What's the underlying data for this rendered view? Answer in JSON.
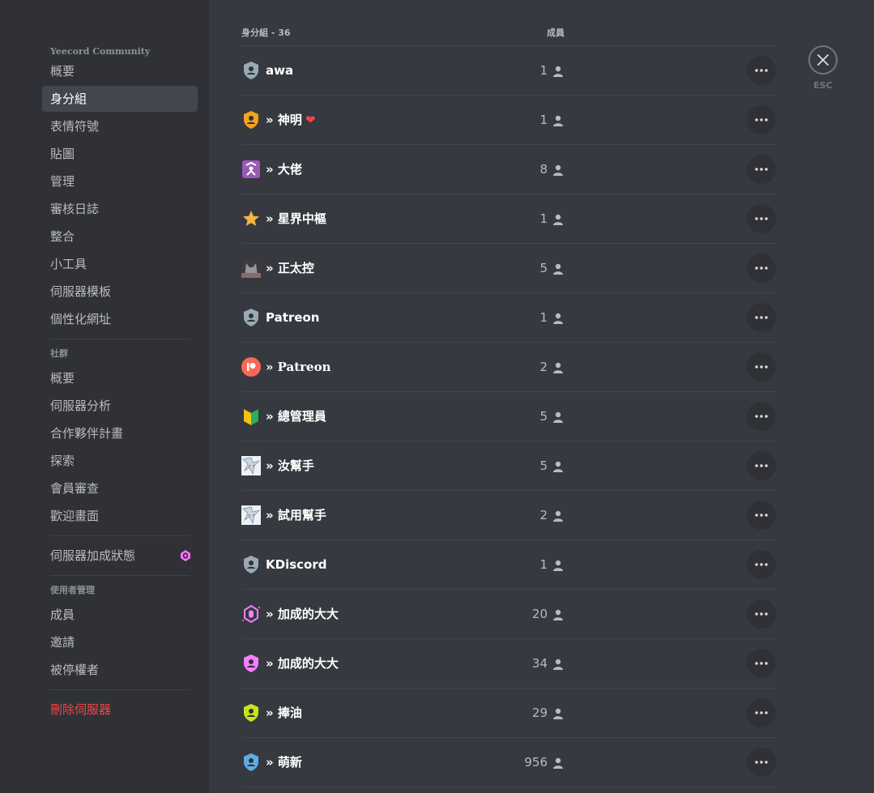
{
  "sidebar": {
    "server_name": "Yeecord Community",
    "server_items": [
      {
        "label": "概要"
      },
      {
        "label": "身分組",
        "active": true
      },
      {
        "label": "表情符號"
      },
      {
        "label": "貼圖"
      },
      {
        "label": "管理"
      },
      {
        "label": "審核日誌"
      },
      {
        "label": "整合"
      },
      {
        "label": "小工具"
      },
      {
        "label": "伺服器模板"
      },
      {
        "label": "個性化網址"
      }
    ],
    "community_header": "社群",
    "community_items": [
      {
        "label": "概要"
      },
      {
        "label": "伺服器分析"
      },
      {
        "label": "合作夥伴計畫"
      },
      {
        "label": "探索"
      },
      {
        "label": "會員審查"
      },
      {
        "label": "歡迎畫面"
      }
    ],
    "boost_label": "伺服器加成狀態",
    "user_mgmt_header": "使用者管理",
    "user_mgmt_items": [
      {
        "label": "成員"
      },
      {
        "label": "邀請"
      },
      {
        "label": "被停權者"
      }
    ],
    "delete_label": "刪除伺服器"
  },
  "roles_header": "身分組 - 36",
  "members_header": "成員",
  "roles": [
    {
      "name": "awa",
      "count": "1",
      "icon": "shield-person-icon",
      "color": "#99aab5"
    },
    {
      "name": "» 神明",
      "count": "1",
      "icon": "shield-person-icon",
      "color": "#f6a21a",
      "heart": "❤"
    },
    {
      "name": "» 大佬",
      "count": "8",
      "icon": "custom-emoji-icon",
      "color": "#9b59b6"
    },
    {
      "name": "» 星界中樞",
      "count": "1",
      "icon": "star-icon",
      "color": "#f4b642"
    },
    {
      "name": "» 正太控",
      "count": "5",
      "icon": "avatar-cat-icon",
      "color": "#8a6a6a"
    },
    {
      "name": "Patreon",
      "count": "1",
      "icon": "shield-person-icon",
      "color": "#99aab5"
    },
    {
      "name": "» Patreon",
      "count": "2",
      "icon": "patreon-icon",
      "color": "#f96854",
      "serif": true
    },
    {
      "name": "» 總管理員",
      "count": "5",
      "icon": "beginner-mark-icon",
      "color": "#f1c40f"
    },
    {
      "name": "» 汝幫手",
      "count": "5",
      "icon": "anime-avatar-icon",
      "color": "#c8d6e5"
    },
    {
      "name": "» 試用幫手",
      "count": "2",
      "icon": "anime-avatar-icon",
      "color": "#c8d6e5"
    },
    {
      "name": "KDiscord",
      "count": "1",
      "icon": "shield-person-icon",
      "color": "#99aab5"
    },
    {
      "name": "» 加成的大大",
      "count": "20",
      "icon": "boost-gem-icon",
      "color": "#f47fff"
    },
    {
      "name": "» 加成的大大",
      "count": "34",
      "icon": "shield-person-icon",
      "color": "#f47fff"
    },
    {
      "name": "» 捧油",
      "count": "29",
      "icon": "shield-person-icon",
      "color": "#c9e31a"
    },
    {
      "name": "» 萌新",
      "count": "956",
      "icon": "shield-person-icon",
      "color": "#5dade2"
    }
  ],
  "close": {
    "esc_label": "ESC"
  }
}
